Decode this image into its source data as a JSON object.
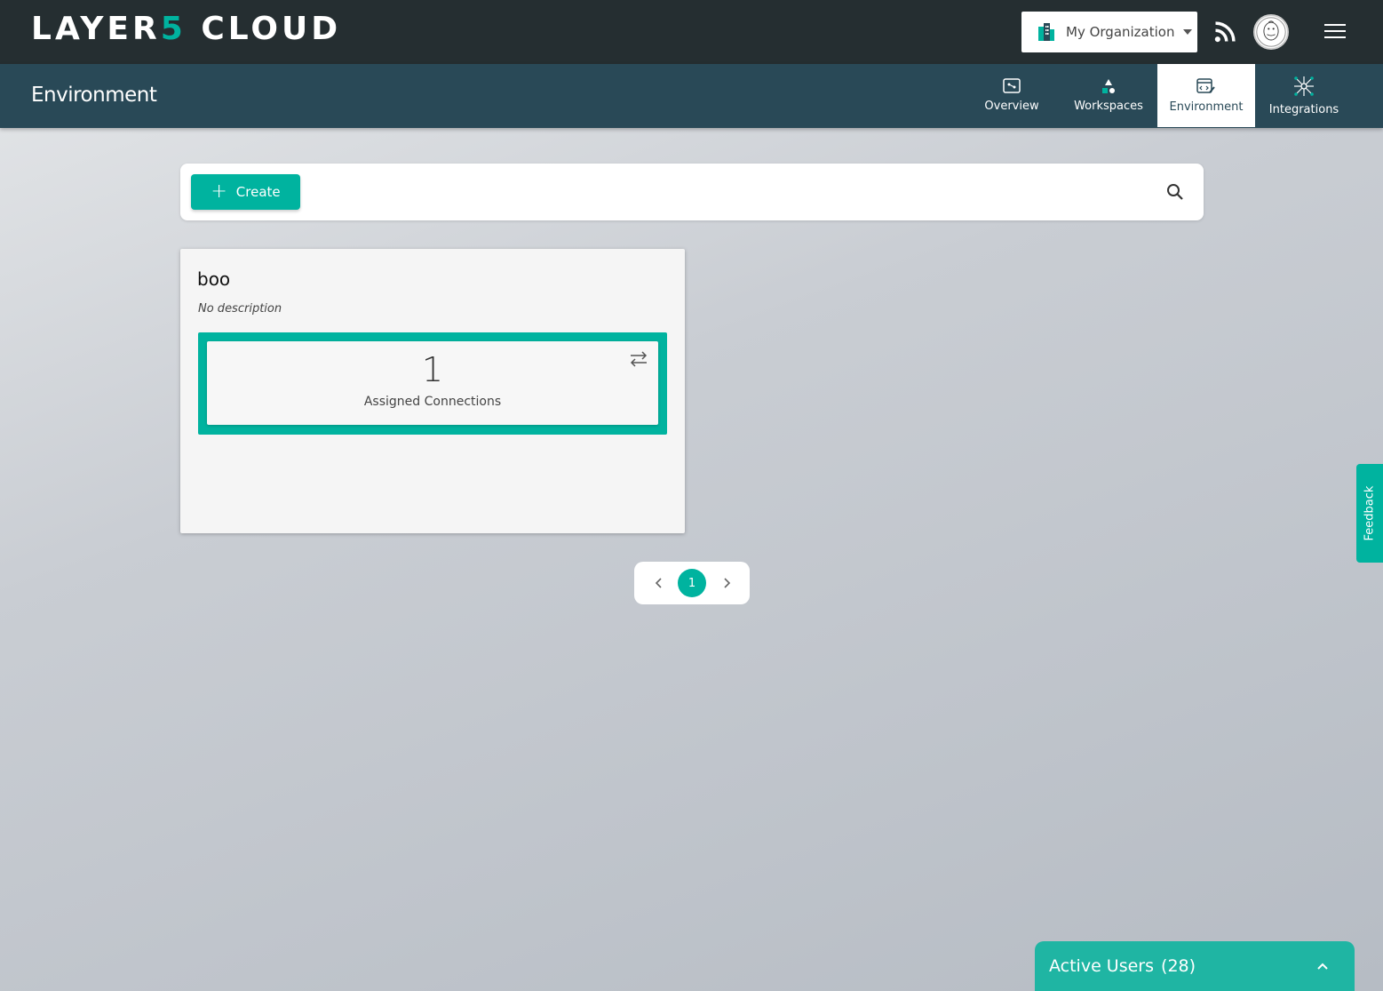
{
  "header": {
    "logo_main": "LAYER",
    "logo_accent": "5",
    "logo_suffix": " CLOUD",
    "org_select": {
      "selected": "My Organization"
    },
    "icons": [
      "organization-icon",
      "rss-icon",
      "avatar",
      "menu-icon"
    ]
  },
  "subheader": {
    "page_title": "Environment",
    "tabs": [
      {
        "label": "Overview",
        "icon": "overview-icon",
        "active": false
      },
      {
        "label": "Workspaces",
        "icon": "workspaces-icon",
        "active": false
      },
      {
        "label": "Environment",
        "icon": "environment-icon",
        "active": true
      },
      {
        "label": "Integrations",
        "icon": "integrations-icon",
        "active": false
      }
    ]
  },
  "toolbar": {
    "create_label": "Create",
    "search_icon": "search-icon"
  },
  "environments": [
    {
      "name": "boo",
      "description": "No description",
      "connections_count": "1",
      "connections_label": "Assigned Connections"
    }
  ],
  "pagination": {
    "current_page": "1"
  },
  "feedback": {
    "label": "Feedback"
  },
  "active_users": {
    "label": "Active Users",
    "count": "(28)"
  },
  "colors": {
    "accent": "#00b39f",
    "topbar": "#252e31",
    "subbar": "#294957"
  }
}
